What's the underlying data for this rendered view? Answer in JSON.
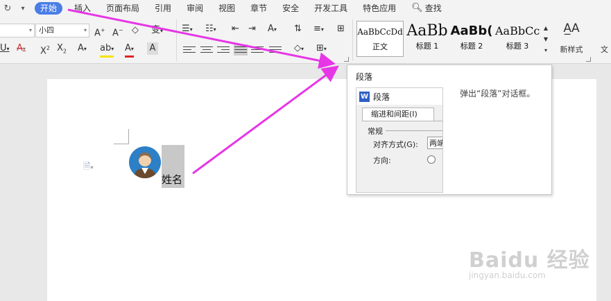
{
  "menubar": {
    "items": [
      "开始",
      "插入",
      "页面布局",
      "引用",
      "审阅",
      "视图",
      "章节",
      "安全",
      "开发工具",
      "特色应用"
    ],
    "search_label": "查找"
  },
  "ribbon": {
    "font_size": "小四",
    "styles": [
      {
        "sample": "AaBbCcDd",
        "name": "正文"
      },
      {
        "sample": "AaBb",
        "name": "标题 1"
      },
      {
        "sample": "AaBb(",
        "name": "标题 2"
      },
      {
        "sample": "AaBbCc",
        "name": "标题 3"
      }
    ],
    "new_style_label": "新样式",
    "more_label": "文"
  },
  "document": {
    "name_text": "姓名"
  },
  "tooltip": {
    "title": "段落",
    "description": "弹出“段落”对话框。",
    "preview": {
      "title": "段落",
      "tab_label": "缩进和间距(I)",
      "section": "常规",
      "align_label": "对齐方式(G):",
      "align_value": "两端",
      "direction_label": "方向:"
    }
  },
  "watermark": {
    "brand": "Baidu 经验",
    "url": "jingyan.baidu.com"
  },
  "colors": {
    "accent": "#4a7ee6",
    "arrow": "#e636e6",
    "avatar_bg": "#2d7fc6"
  }
}
